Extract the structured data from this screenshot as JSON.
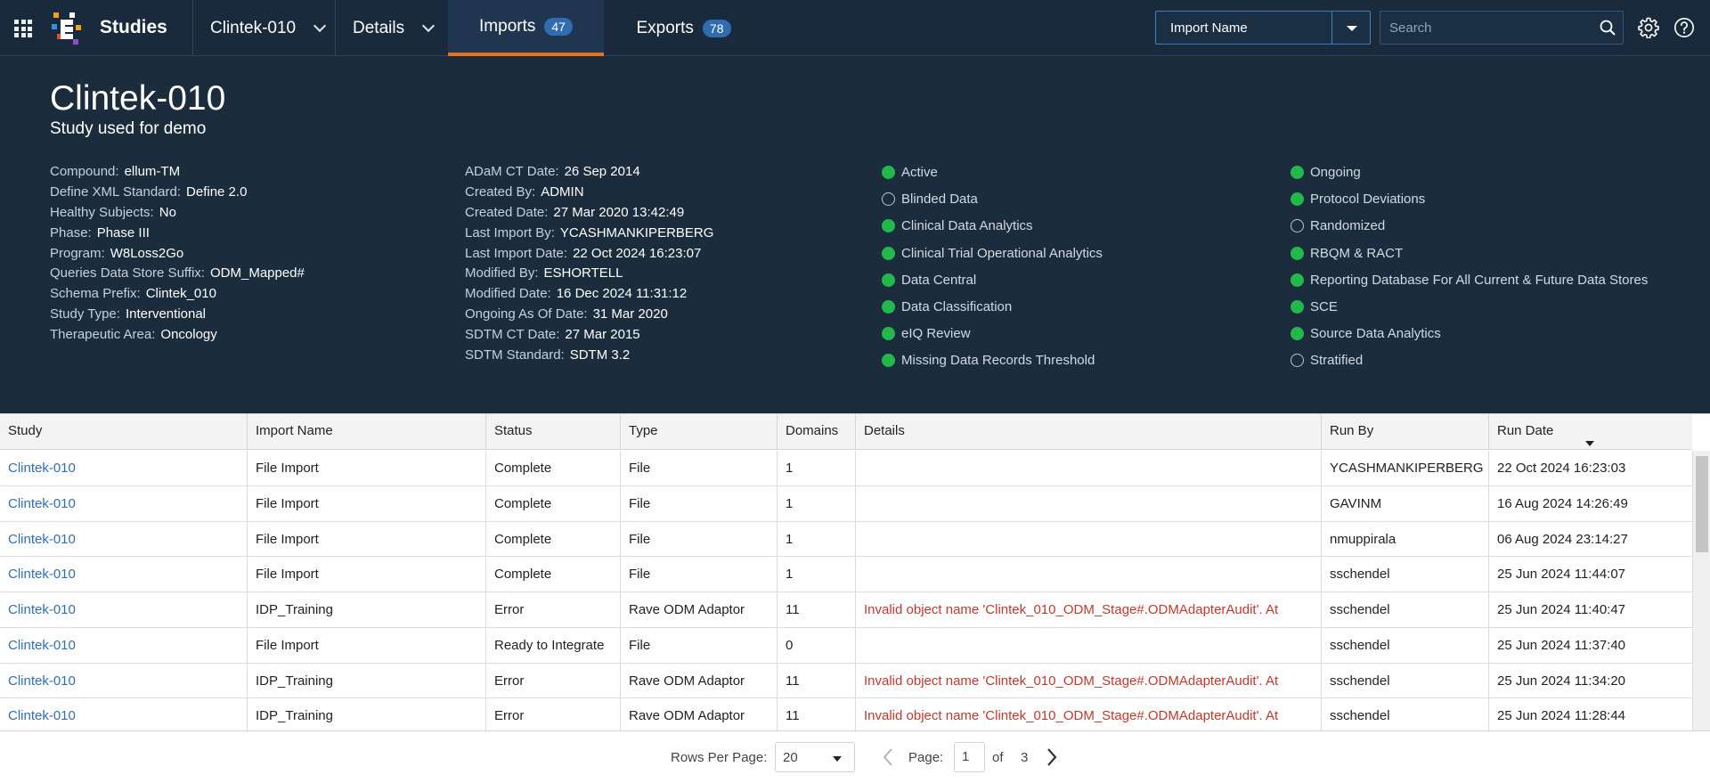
{
  "nav": {
    "brand": "Studies",
    "study_selector": "Clintek-010",
    "details_label": "Details",
    "tabs": [
      {
        "label": "Imports",
        "count": "47",
        "active": true
      },
      {
        "label": "Exports",
        "count": "78",
        "active": false
      }
    ],
    "filter_field": "Import Name",
    "search_placeholder": "Search"
  },
  "study": {
    "title": "Clintek-010",
    "subtitle": "Study used for demo",
    "props_col1": [
      {
        "k": "Compound:",
        "v": "ellum-TM"
      },
      {
        "k": "Define XML Standard:",
        "v": "Define 2.0"
      },
      {
        "k": "Healthy Subjects:",
        "v": "No"
      },
      {
        "k": "Phase:",
        "v": "Phase III"
      },
      {
        "k": "Program:",
        "v": "W8Loss2Go"
      },
      {
        "k": "Queries Data Store Suffix:",
        "v": "ODM_Mapped#"
      },
      {
        "k": "Schema Prefix:",
        "v": "Clintek_010"
      },
      {
        "k": "Study Type:",
        "v": "Interventional"
      },
      {
        "k": "Therapeutic Area:",
        "v": "Oncology"
      }
    ],
    "props_col2": [
      {
        "k": "ADaM CT Date:",
        "v": "26 Sep 2014"
      },
      {
        "k": "Created By:",
        "v": "ADMIN"
      },
      {
        "k": "Created Date:",
        "v": "27 Mar 2020 13:42:49"
      },
      {
        "k": "Last Import By:",
        "v": "YCASHMANKIPERBERG"
      },
      {
        "k": "Last Import Date:",
        "v": "22 Oct 2024 16:23:07"
      },
      {
        "k": "Modified By:",
        "v": "ESHORTELL"
      },
      {
        "k": "Modified Date:",
        "v": "16 Dec 2024 11:31:12"
      },
      {
        "k": "Ongoing As Of Date:",
        "v": "31 Mar 2020"
      },
      {
        "k": "SDTM CT Date:",
        "v": "27 Mar 2015"
      },
      {
        "k": "SDTM Standard:",
        "v": "SDTM 3.2"
      }
    ],
    "flags_col1": [
      {
        "label": "Active",
        "on": true
      },
      {
        "label": "Blinded Data",
        "on": false
      },
      {
        "label": "Clinical Data Analytics",
        "on": true
      },
      {
        "label": "Clinical Trial Operational Analytics",
        "on": true
      },
      {
        "label": "Data Central",
        "on": true
      },
      {
        "label": "Data Classification",
        "on": true
      },
      {
        "label": "eIQ Review",
        "on": true
      },
      {
        "label": "Missing Data Records Threshold",
        "on": true
      }
    ],
    "flags_col2": [
      {
        "label": "Ongoing",
        "on": true
      },
      {
        "label": "Protocol Deviations",
        "on": true
      },
      {
        "label": "Randomized",
        "on": false
      },
      {
        "label": "RBQM & RACT",
        "on": true
      },
      {
        "label": "Reporting Database For All Current & Future Data Stores",
        "on": true
      },
      {
        "label": "SCE",
        "on": true
      },
      {
        "label": "Source Data Analytics",
        "on": true
      },
      {
        "label": "Stratified",
        "on": false
      }
    ],
    "status_colors": {
      "on": "#22b94a",
      "off": "transparent"
    }
  },
  "table": {
    "columns": [
      "Study",
      "Import Name",
      "Status",
      "Type",
      "Domains",
      "Details",
      "Run By",
      "Run Date"
    ],
    "sorted_column": "Run Date",
    "rows": [
      {
        "study": "Clintek-010",
        "import_name": "File Import",
        "status": "Complete",
        "type": "File",
        "domains": "1",
        "details": "",
        "run_by": "YCASHMANKIPERBERG",
        "run_date": "22 Oct 2024 16:23:03"
      },
      {
        "study": "Clintek-010",
        "import_name": "File Import",
        "status": "Complete",
        "type": "File",
        "domains": "1",
        "details": "",
        "run_by": "GAVINM",
        "run_date": "16 Aug 2024 14:26:49"
      },
      {
        "study": "Clintek-010",
        "import_name": "File Import",
        "status": "Complete",
        "type": "File",
        "domains": "1",
        "details": "",
        "run_by": "nmuppirala",
        "run_date": "06 Aug 2024 23:14:27"
      },
      {
        "study": "Clintek-010",
        "import_name": "File Import",
        "status": "Complete",
        "type": "File",
        "domains": "1",
        "details": "",
        "run_by": "sschendel",
        "run_date": "25 Jun 2024 11:44:07"
      },
      {
        "study": "Clintek-010",
        "import_name": "IDP_Training",
        "status": "Error",
        "type": "Rave ODM Adaptor",
        "domains": "11",
        "details": "Invalid object name 'Clintek_010_ODM_Stage#.ODMAdapterAudit'. At",
        "run_by": "sschendel",
        "run_date": "25 Jun 2024 11:40:47"
      },
      {
        "study": "Clintek-010",
        "import_name": "File Import",
        "status": "Ready to Integrate",
        "type": "File",
        "domains": "0",
        "details": "",
        "run_by": "sschendel",
        "run_date": "25 Jun 2024 11:37:40"
      },
      {
        "study": "Clintek-010",
        "import_name": "IDP_Training",
        "status": "Error",
        "type": "Rave ODM Adaptor",
        "domains": "11",
        "details": "Invalid object name 'Clintek_010_ODM_Stage#.ODMAdapterAudit'. At",
        "run_by": "sschendel",
        "run_date": "25 Jun 2024 11:34:20"
      },
      {
        "study": "Clintek-010",
        "import_name": "IDP_Training",
        "status": "Error",
        "type": "Rave ODM Adaptor",
        "domains": "11",
        "details": "Invalid object name 'Clintek_010_ODM_Stage#.ODMAdapterAudit'. At",
        "run_by": "sschendel",
        "run_date": "25 Jun 2024 11:28:44"
      }
    ],
    "error_color": "#c0392b",
    "link_color": "#2f6fb3"
  },
  "pager": {
    "rows_label": "Rows Per Page:",
    "rows_per_page": "20",
    "page_label": "Page:",
    "page": "1",
    "of_label": "of",
    "total_pages": "3"
  },
  "icons": {
    "apps": "apps-grid-icon",
    "search": "search-icon",
    "settings": "gear-icon",
    "help": "help-icon",
    "prev": "chevron-left-icon",
    "next": "chevron-right-icon"
  }
}
